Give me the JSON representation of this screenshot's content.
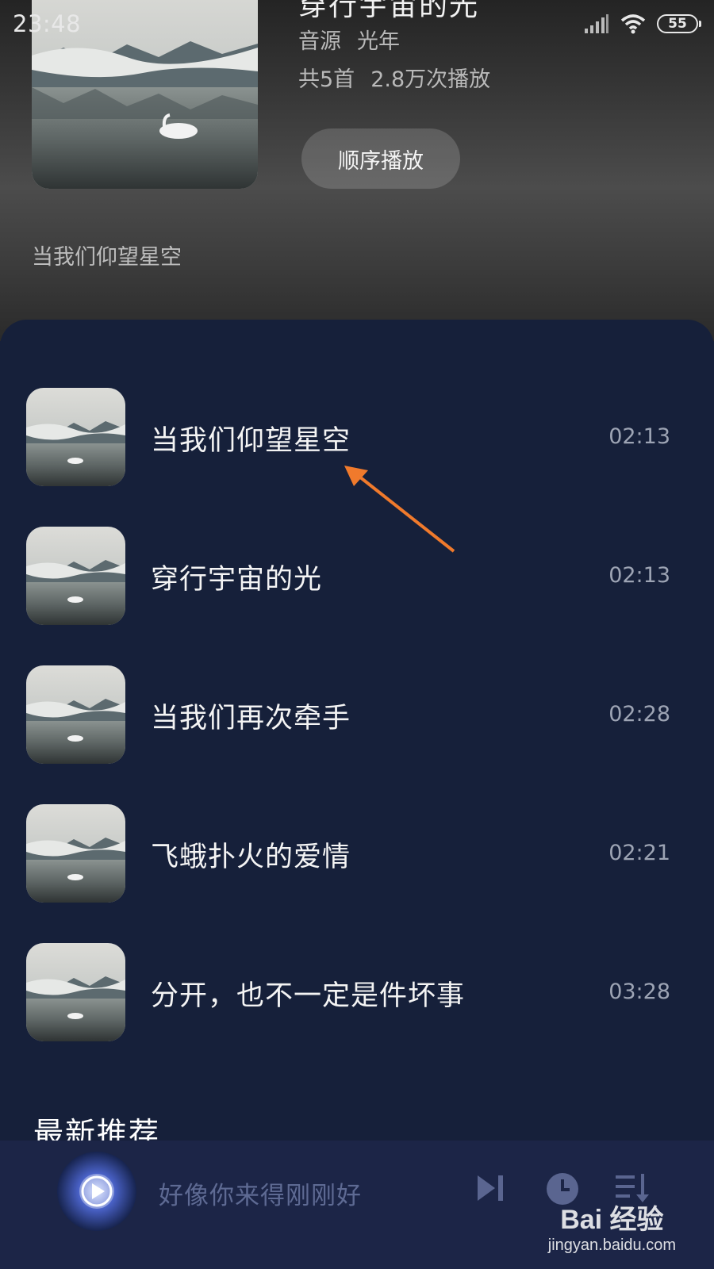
{
  "status_bar": {
    "time": "23:48",
    "battery": "55"
  },
  "album": {
    "title": "穿行宇宙的光",
    "source": "音源",
    "source_name": "光年",
    "track_count": "共5首",
    "play_count": "2.8万次播放",
    "play_order_label": "顺序播放",
    "description": "当我们仰望星空"
  },
  "songs": [
    {
      "title": "当我们仰望星空",
      "duration": "02:13"
    },
    {
      "title": "穿行宇宙的光",
      "duration": "02:13"
    },
    {
      "title": "当我们再次牵手",
      "duration": "02:28"
    },
    {
      "title": "飞蛾扑火的爱情",
      "duration": "02:21"
    },
    {
      "title": "分开，也不一定是件坏事",
      "duration": "03:28"
    }
  ],
  "section": {
    "title": "最新推荐"
  },
  "player": {
    "now_playing": "好像你来得刚刚好"
  },
  "watermark": {
    "brand": "Bai 经验",
    "url": "jingyan.baidu.com"
  },
  "colors": {
    "panel": "#16203a",
    "player": "#1c2547",
    "accent_arrow": "#f07a2c",
    "player_icons": "#5a6590"
  },
  "icons": [
    "signal-icon",
    "wifi-icon",
    "battery-icon",
    "next-track-icon",
    "timer-icon",
    "playlist-icon",
    "play-icon"
  ]
}
